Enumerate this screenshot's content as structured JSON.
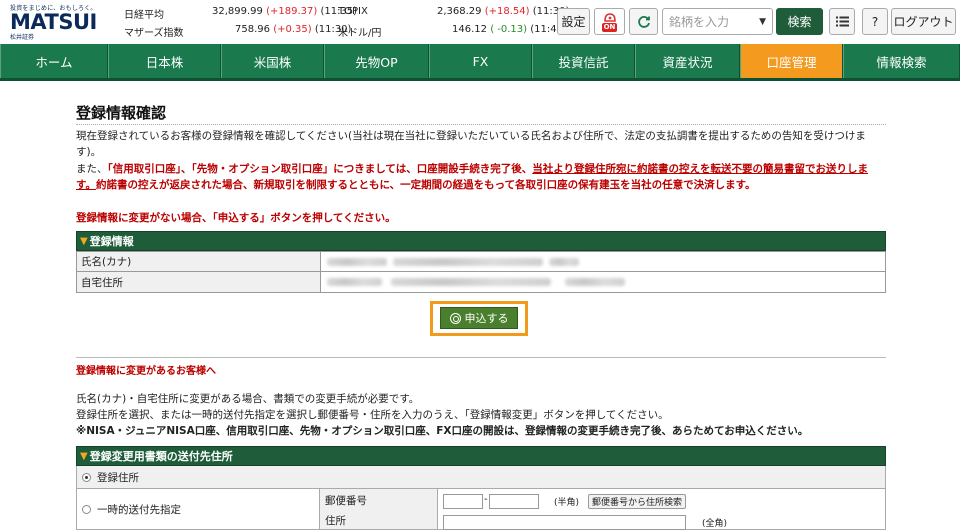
{
  "header": {
    "logo": {
      "tagline": "投資をまじめに、おもしろく。",
      "name": "MATSUI",
      "sub": "松井証券"
    },
    "markets": [
      {
        "name": "日経平均",
        "value": "32,899.99",
        "change": "(+189.37)",
        "change_dir": "up",
        "time": "(11:35)"
      },
      {
        "name": "マザーズ指数",
        "value": "758.96",
        "change": "(+0.35)",
        "change_dir": "up",
        "time": "(11:30)"
      },
      {
        "name": "TOPIX",
        "value": "2,368.29",
        "change": "(+18.54)",
        "change_dir": "up",
        "time": "(11:30)"
      },
      {
        "name": "米ドル/円",
        "value": "146.12",
        "change": "( -0.13)",
        "change_dir": "down",
        "time": "(11:42)"
      }
    ],
    "settings_label": "設定",
    "sound_label": "ON",
    "search_placeholder": "銘柄を入力",
    "search_button": "検索",
    "help_label": "?",
    "logout_label": "ログアウト"
  },
  "nav": {
    "tabs": [
      {
        "label": "ホーム",
        "active": false
      },
      {
        "label": "日本株",
        "active": false
      },
      {
        "label": "米国株",
        "active": false
      },
      {
        "label": "先物OP",
        "active": false
      },
      {
        "label": "FX",
        "active": false
      },
      {
        "label": "投資信託",
        "active": false
      },
      {
        "label": "資産状況",
        "active": false
      },
      {
        "label": "口座管理",
        "active": true
      },
      {
        "label": "情報検索",
        "active": false
      }
    ]
  },
  "page": {
    "title": "登録情報確認",
    "intro1": "現在登録されているお客様の登録情報を確認してください(当社は現在当社に登録いただいている氏名および住所で、法定の支払調書を提出するための告知を受けつけま",
    "intro1b": "す)。",
    "intro2_a": "また、",
    "intro2_b": "「信用取引口座」、「先物・オプション取引口座」につきましては、口座開設手続き完了後、",
    "intro2_c": "当社より登録住所宛に約諾書の控えを転送不要の簡易書留でお送りしま",
    "intro2_d": "す。",
    "intro2_e": "約諾書の控えが返戻された場合、新規取引を制限するとともに、一定期間の経過をもって各取引口座の保有建玉を当社の任意で決済します。",
    "no_change_notice": "登録情報に変更がない場合、「申込する」ボタンを押してください。",
    "reg_section_title": "登録情報",
    "reg_rows": [
      {
        "label": "氏名(カナ)"
      },
      {
        "label": "自宅住所"
      }
    ],
    "apply_button": "申込する",
    "change_heading": "登録情報に変更があるお客様へ",
    "change_line1": "氏名(カナ)・自宅住所に変更がある場合、書類での変更手続が必要です。",
    "change_line2": "登録住所を選択、または一時的送付先指定を選択し郵便番号・住所を入力のうえ、「登録情報変更」ボタンを押してください。",
    "change_line3": "※NISA・ジュニアNISA口座、信用取引口座、先物・オプション取引口座、FX口座の開設は、登録情報の変更手続き完了後、あらためてお申込ください。",
    "dest_section_title": "登録変更用書類の送付先住所",
    "dest_option_registered": "登録住所",
    "dest_option_temporary": "一時的送付先指定",
    "postal_label": "郵便番号",
    "postal_hint": "(半角)",
    "postal_search_button": "郵便番号から住所検索",
    "address_label": "住所",
    "address_hint": "(全角)"
  }
}
